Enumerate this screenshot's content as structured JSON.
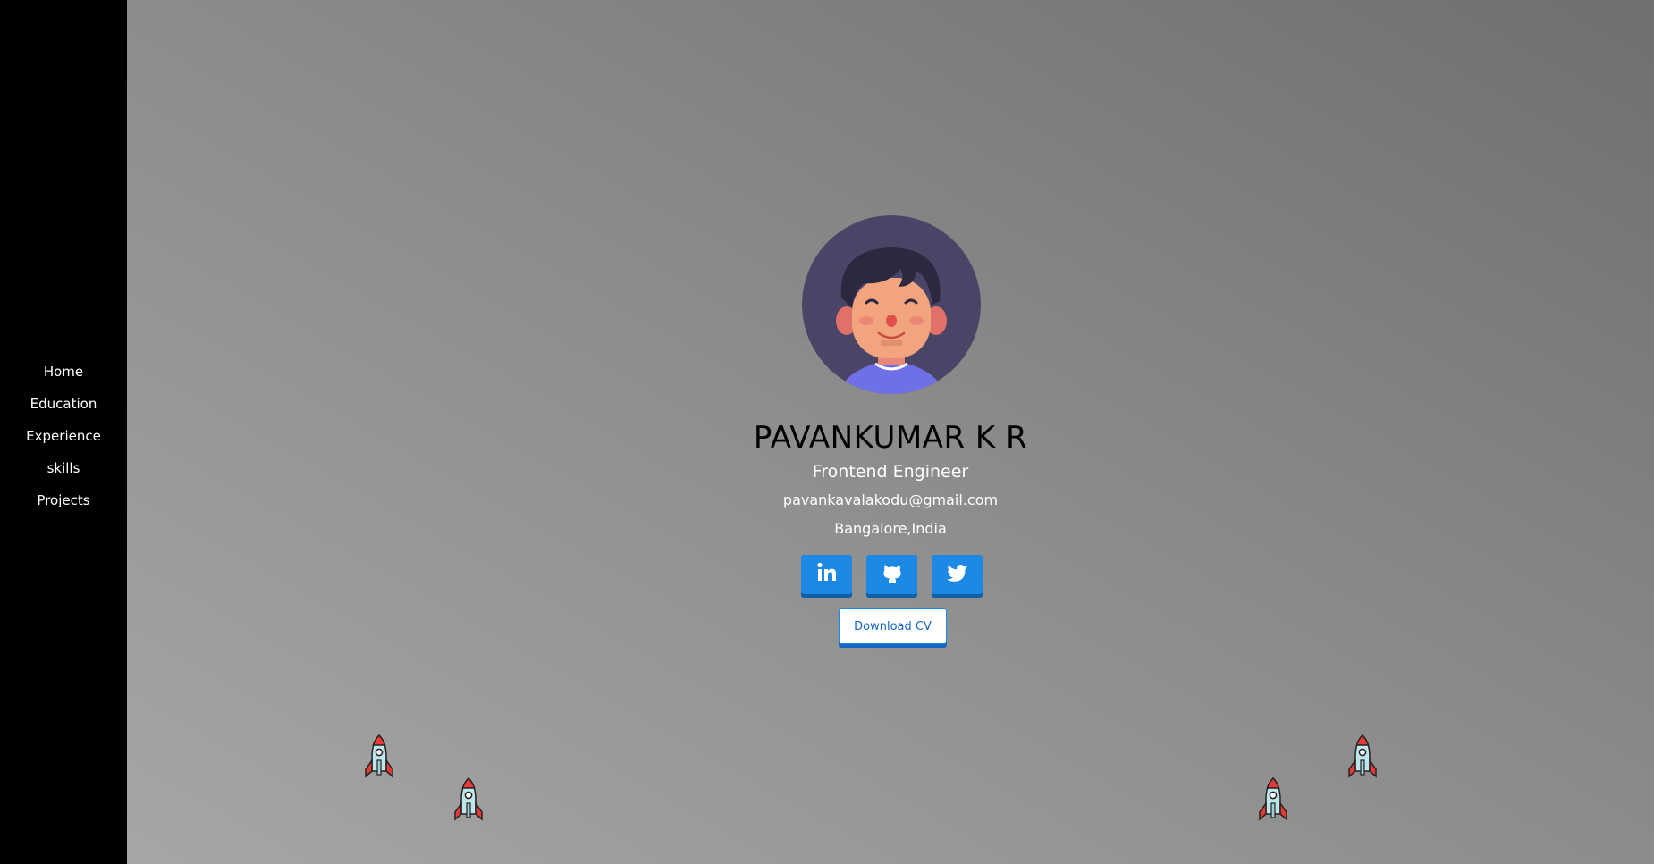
{
  "sidebar": {
    "items": [
      {
        "label": "Home"
      },
      {
        "label": "Education"
      },
      {
        "label": "Experience"
      },
      {
        "label": "skills"
      },
      {
        "label": "Projects"
      }
    ]
  },
  "profile": {
    "name": "PAVANKUMAR K R",
    "role": "Frontend Engineer",
    "email": "pavankavalakodu@gmail.com",
    "location": "Bangalore,India",
    "download_label": "Download CV"
  },
  "social": [
    {
      "icon": "linkedin-icon"
    },
    {
      "icon": "github-icon"
    },
    {
      "icon": "twitter-icon"
    }
  ],
  "colors": {
    "sidebar_bg": "#000000",
    "accent": "#1e88e5",
    "avatar_bg": "#4a4466"
  },
  "decorations": {
    "rocket_icon": "rocket-icon"
  }
}
